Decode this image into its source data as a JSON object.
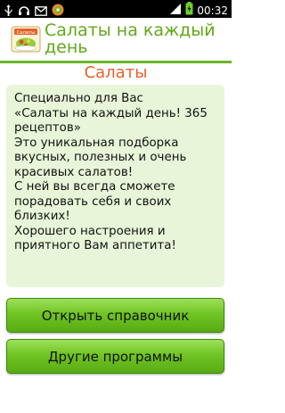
{
  "status_bar": {
    "time": "00:32",
    "left_icons": [
      "usb-icon",
      "headset-icon",
      "message-icon",
      "app-notification-icon"
    ],
    "right_icons": [
      "signal-icon",
      "battery-icon"
    ]
  },
  "header": {
    "logo_text": "Салаты",
    "title": "Салаты на каждый день",
    "accent_color": "#62a81a"
  },
  "section_title": "Салаты",
  "description": "Специально для Вас\n«Салаты на каждый день! 365 рецептов»\nЭто уникальная подборка вкусных, полезных и очень красивых салатов!\nС ней вы всегда сможете порадовать себя и своих близких!\nХорошего настроения и приятного Вам аппетита!",
  "buttons": {
    "open_reference": "Открыть справочник",
    "other_programs": "Другие программы"
  }
}
